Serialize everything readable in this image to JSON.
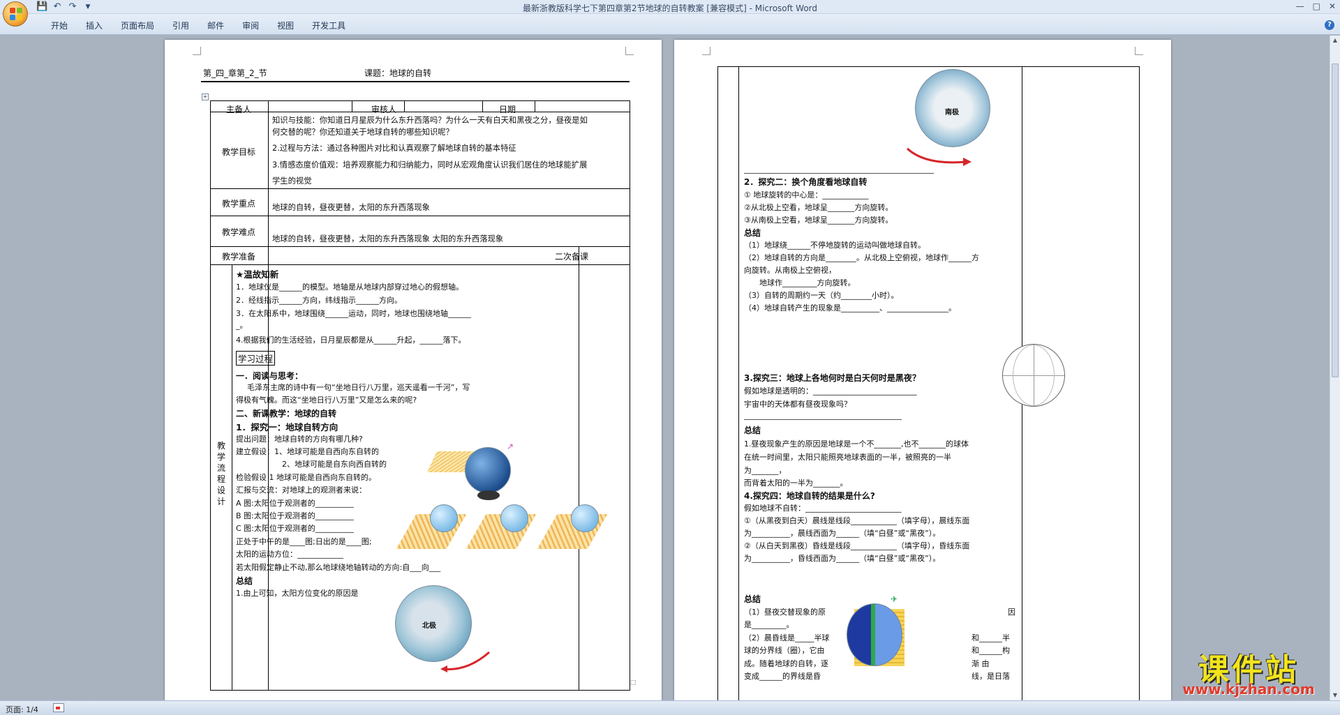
{
  "app": {
    "window_title": "最新浙教版科学七下第四章第2节地球的自转教案 [兼容模式] - Microsoft Word",
    "help": "?"
  },
  "ribbon": {
    "tabs": [
      "开始",
      "插入",
      "页面布局",
      "引用",
      "邮件",
      "审阅",
      "视图",
      "开发工具"
    ]
  },
  "status": {
    "page": "页面: 1/4"
  },
  "watermark": {
    "title": "课件站",
    "url": "www.kjzhan.com"
  },
  "page1": {
    "header": {
      "chapter": "第_四_章第_2_节",
      "lesson": "课题：地球的自转"
    },
    "row1": {
      "preparer": "主备人",
      "reviewer": "审核人",
      "date": "日期"
    },
    "goals_label": "教学目标",
    "goals": [
      "知识与技能：你知道日月星辰为什么东升西落吗？为什么一天有白天和黑夜之分，昼夜是如",
      "何交替的呢？你还知道关于地球自转的哪些知识呢？",
      "2.过程与方法：通过各种图片对比和认真观察了解地球自转的基本特征",
      "3.情感态度价值观：培养观察能力和归纳能力，同时从宏观角度认识我们居住的地球能扩展",
      "学生的视觉"
    ],
    "key_label": "教学重点",
    "key_text": "地球的自转，昼夜更替，太阳的东升西落现象",
    "diff_label": "教学难点",
    "diff_text": "地球的自转，昼夜更替，太阳的东升西落现象   太阳的东升西落现象",
    "prep_label": "教学准备",
    "second_label": "二次备课",
    "flow_label": [
      "教",
      "学",
      "流",
      "程",
      "设",
      "计"
    ],
    "body": {
      "review_title": "★温故知新",
      "review": [
        "1．地球仪是______的模型。地轴是从地球内部穿过地心的假想轴。",
        "2．经线指示______方向，纬线指示______方向。",
        "3．在太阳系中，地球围绕______运动，同时，地球也围绕地轴______",
        "_。",
        "4.根据我们的生活经验，日月星辰都是从______升起，______落下。"
      ],
      "process_box": "学习过程",
      "s1_title": "一．阅读与思考：",
      "s1_text": [
        "毛泽东主席的诗中有一句“坐地日行八万里，巡天遥看一千河”，写",
        "得极有气魄。而这“坐地日行八万里”又是怎么来的呢?"
      ],
      "s2_title": "二、新课教学：地球的自转",
      "s2_sub": "1．探究一：地球自转方向",
      "s2_lines": [
        "提出问题：地球自转的方向有哪几种?",
        "建立假设：1、地球可能是自西向东自转的",
        "2、地球可能是自东向西自转的",
        "检验假设 1 地球可能是自西向东自转的。",
        "汇报与交流：对地球上的观测者来说：",
        "A 图:太阳位于观测者的__________",
        "B 图:太阳位于观测者的__________",
        "C 图:太阳位于观测者的__________",
        "正处于中午的是____图;日出的是____图;",
        "太阳的运动方位：____________",
        "若太阳假定静止不动,那么地球绕地轴转动的方向:自___向___"
      ],
      "sum_title": "总结",
      "sum_text": "1.由上可知，太阳方位变化的原因是",
      "map_label": "北极"
    }
  },
  "page2": {
    "map_label": "南极",
    "s2_title": "2．探究二：换个角度看地球自转",
    "s2_lines": [
      "①  地球旋转的中心是：____________",
      "②从北极上空看，地球呈_______方向旋转。",
      "③从南极上空看，地球呈_______方向旋转。"
    ],
    "sum_title": "总结",
    "sum_lines": [
      "（1）地球绕______不停地旋转的运动叫做地球自转。",
      "（2）地球自转的方向是________。从北极上空俯视，地球作______方",
      "向旋转。从南极上空俯视，",
      "地球作_________方向旋转。",
      "（3）自转的周期约一天（约________小时）。",
      "（4）地球自转产生的现象是__________、________________。"
    ],
    "s3_title": "3.探究三：地球上各地何时是白天何时是黑夜？",
    "s3_lines": [
      "假如地球是透明的：___________________________",
      "宇宙中的天体都有昼夜现象吗？"
    ],
    "sum2_title": "总结",
    "sum2_lines": [
      "1.昼夜现象产生的原因是地球是一个不_______,也不_______的球体",
      "在统一时间里，太阳只能照亮地球表面的一半，被照亮的一半",
      "为_______，",
      "而背着太阳的一半为_______。"
    ],
    "s4_title": "4.探究四：地球自转的结果是什么?",
    "s4_lines": [
      "假如地球不自转：_________________________",
      "①（从黑夜到白天）晨线是线段____________（填字母），晨线东面",
      "为__________，晨线西面为______（填“白昼”或“黑夜”）。",
      "②（从白天到黑夜）昏线是线段____________（填字母），昏线东面",
      "为__________，昏线西面为______（填“白昼”或“黑夜”）。"
    ],
    "sum3_title": "总结",
    "sum3_lines": [
      "（1）昼夜交替现象的原",
      "是_________。",
      "（2）晨昏线是_____半球",
      "球的分界线（圈），它由",
      "成。随着地球的自转，逐",
      "变成______的界线是昏"
    ],
    "sum3_right": [
      "因",
      "和______半",
      "和______构",
      "渐      由",
      "线，是日落"
    ]
  }
}
